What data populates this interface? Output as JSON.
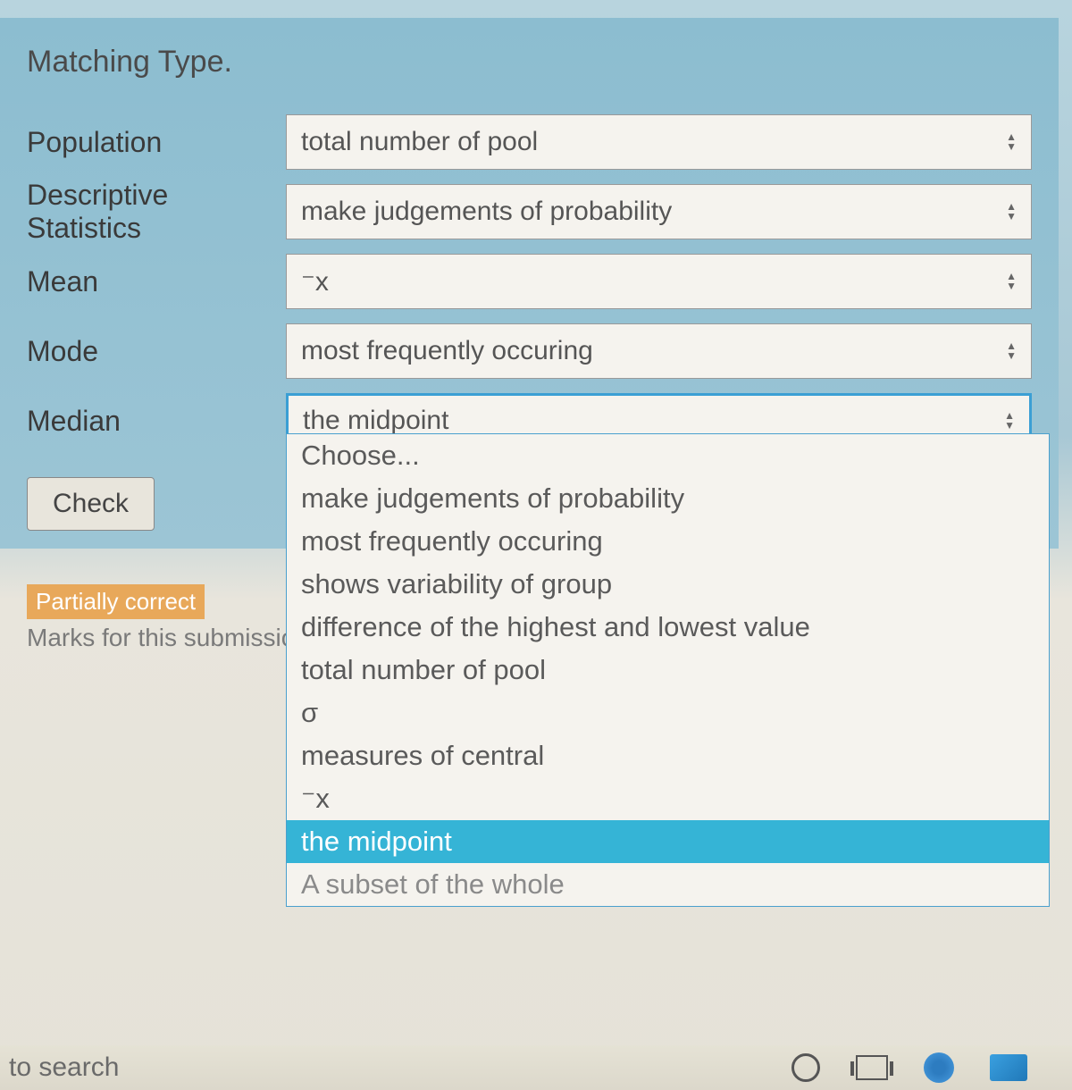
{
  "quiz": {
    "title": "Matching Type.",
    "rows": [
      {
        "label": "Population",
        "value": "total number of pool"
      },
      {
        "label": "Descriptive Statistics",
        "value": "make judgements of probability"
      },
      {
        "label": "Mean",
        "value": "⁻x"
      },
      {
        "label": "Mode",
        "value": "most frequently occuring"
      },
      {
        "label": "Median",
        "value": "the midpoint"
      }
    ],
    "check_label": "Check",
    "dropdown_options": [
      "Choose...",
      "make judgements of probability",
      "most frequently occuring",
      "shows variability of group",
      "difference of the highest and lowest value",
      "total number of pool",
      "σ",
      "measures of central",
      "⁻x",
      "the midpoint",
      "A subset of the whole"
    ],
    "dropdown_selected": "the midpoint"
  },
  "feedback": {
    "badge": "Partially correct",
    "marks_text": "Marks for this submission"
  },
  "taskbar": {
    "search_text": "to search"
  }
}
